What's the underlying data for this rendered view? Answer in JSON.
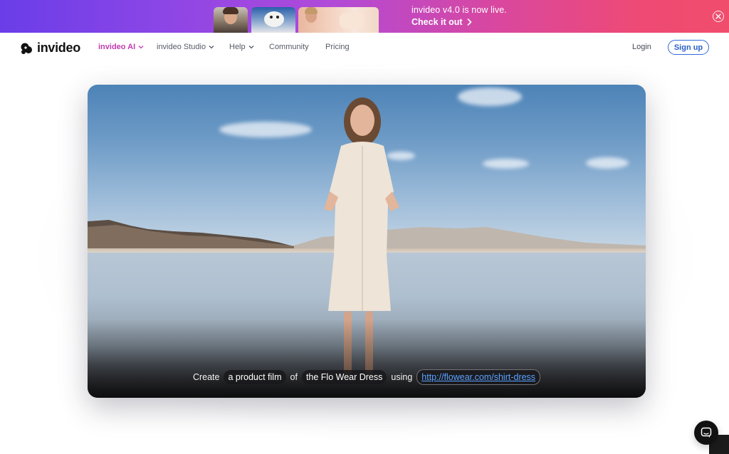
{
  "banner": {
    "announcement": "invideo v4.0 is now live.",
    "cta": "Check it out",
    "colors": {
      "gradient_start": "#6a3de8",
      "gradient_end": "#f04d6c"
    }
  },
  "nav": {
    "logo": "invideo",
    "items": [
      {
        "label": "invideo AI",
        "has_dropdown": true,
        "active": true
      },
      {
        "label": "invideo Studio",
        "has_dropdown": true,
        "active": false
      },
      {
        "label": "Help",
        "has_dropdown": true,
        "active": false
      },
      {
        "label": "Community",
        "has_dropdown": false,
        "active": false
      },
      {
        "label": "Pricing",
        "has_dropdown": false,
        "active": false
      }
    ],
    "login": "Login",
    "signup": "Sign up",
    "colors": {
      "active": "#c13bb0",
      "signup": "#2f6bd8"
    }
  },
  "hero": {
    "prompt": {
      "word_create": "Create",
      "chip_type": "a product film",
      "word_of": "of",
      "chip_subject": "the Flo Wear Dress",
      "word_using": "using",
      "chip_url": "http://flowear.com/shirt-dress"
    }
  },
  "icons": {
    "close": "close-circle-icon",
    "chevron": "chevron-down-icon",
    "arrow": "chevron-right-icon",
    "chat": "chat-icon",
    "logo": "invideo-logo-icon"
  }
}
